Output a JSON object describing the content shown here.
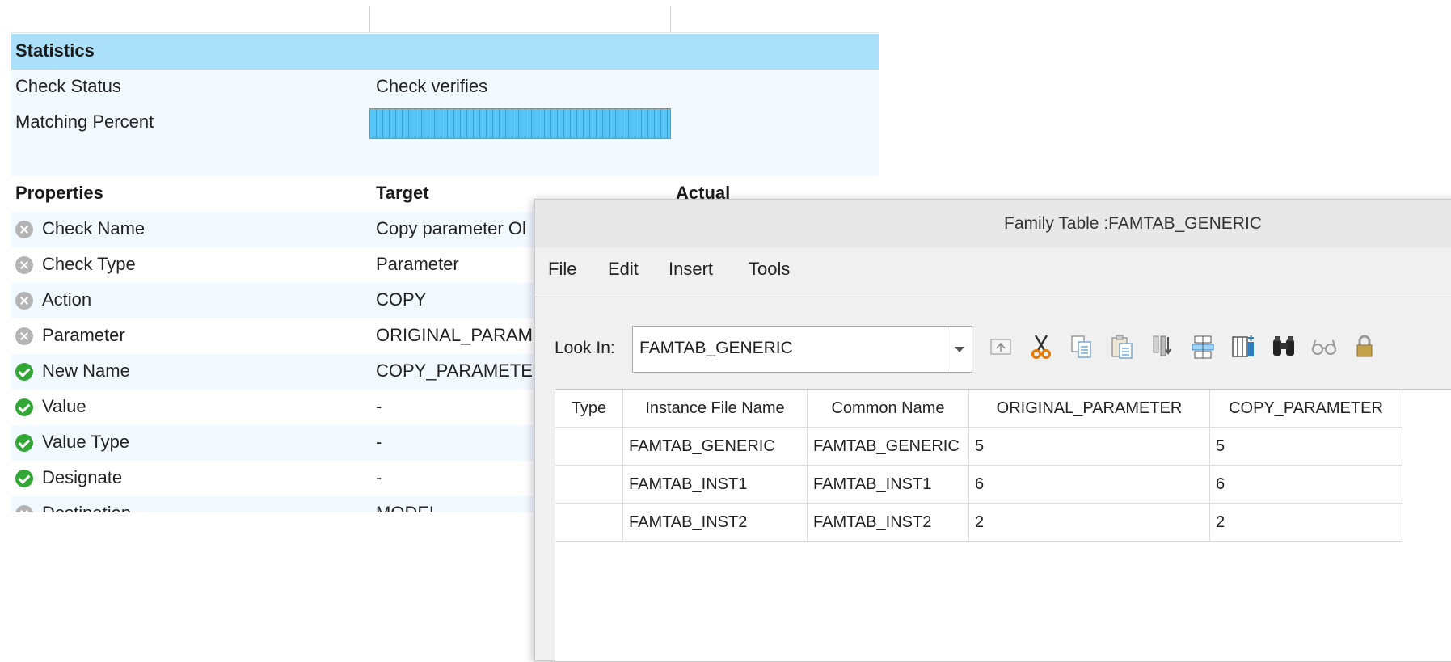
{
  "report": {
    "statistics_header": "Statistics",
    "check_status_label": "Check Status",
    "check_status_value": "Check verifies",
    "matching_percent_label": "Matching Percent",
    "matching_percent_fraction": 1.0,
    "properties_header": {
      "col1": "Properties",
      "col2": "Target",
      "col3": "Actual"
    },
    "properties": [
      {
        "status": "fail",
        "name": "Check Name",
        "target": "Copy parameter Ol"
      },
      {
        "status": "fail",
        "name": "Check Type",
        "target": "Parameter"
      },
      {
        "status": "fail",
        "name": "Action",
        "target": "COPY"
      },
      {
        "status": "fail",
        "name": "Parameter",
        "target": "ORIGINAL_PARAM"
      },
      {
        "status": "ok",
        "name": "New Name",
        "target": "COPY_PARAMETER"
      },
      {
        "status": "ok",
        "name": "Value",
        "target": "-"
      },
      {
        "status": "ok",
        "name": "Value Type",
        "target": "-"
      },
      {
        "status": "ok",
        "name": "Designate",
        "target": "-"
      },
      {
        "status": "fail",
        "name": "Destination",
        "target": "MODEL"
      }
    ]
  },
  "dialog": {
    "title": "Family Table :FAMTAB_GENERIC",
    "menu": [
      "File",
      "Edit",
      "Insert",
      "Tools"
    ],
    "look_in_label": "Look In:",
    "look_in_value": "FAMTAB_GENERIC",
    "toolbar_icons": [
      "up-folder-icon",
      "cut-icon",
      "copy-icon",
      "paste-icon",
      "insert-column-icon",
      "table-columns-icon",
      "add-column-icon",
      "binoculars-icon",
      "glasses-icon",
      "lock-icon"
    ],
    "table": {
      "columns": [
        "Type",
        "Instance File Name",
        "Common Name",
        "ORIGINAL_PARAMETER",
        "COPY_PARAMETER"
      ],
      "rows": [
        [
          "",
          "FAMTAB_GENERIC",
          "FAMTAB_GENERIC",
          "5",
          "5"
        ],
        [
          "",
          "FAMTAB_INST1",
          "FAMTAB_INST1",
          "6",
          "6"
        ],
        [
          "",
          "FAMTAB_INST2",
          "FAMTAB_INST2",
          "2",
          "2"
        ]
      ]
    }
  },
  "colors": {
    "statistics_header_bg": "#abe0fb",
    "progress_fill": "#57c5f5",
    "ok_icon": "#31a835",
    "fail_icon": "#b4b4b4"
  }
}
